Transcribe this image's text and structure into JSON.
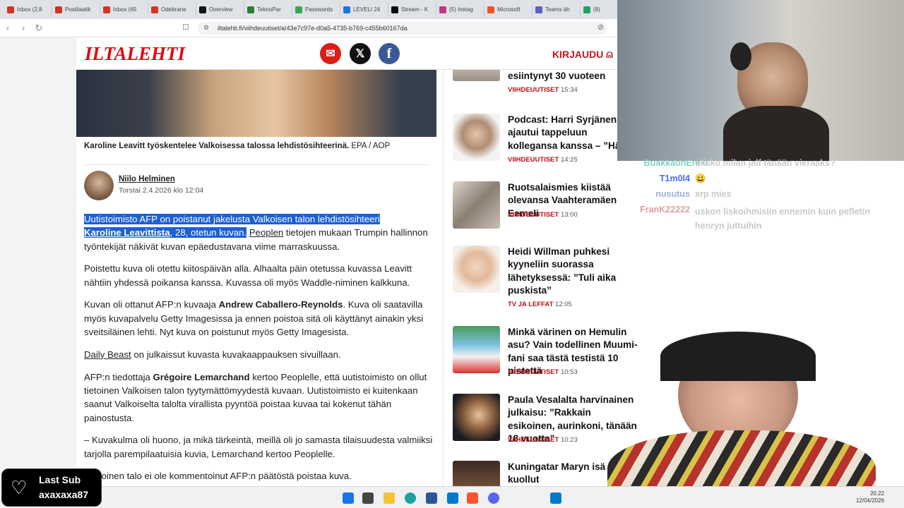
{
  "browser": {
    "tabs": [
      {
        "label": "Inbox (2,8",
        "color": "#d93025"
      },
      {
        "label": "Postilaatik",
        "color": "#d93025"
      },
      {
        "label": "Inbox (65",
        "color": "#d93025"
      },
      {
        "label": "Odebrane",
        "color": "#d93025"
      },
      {
        "label": "Overview",
        "color": "#111111"
      },
      {
        "label": "TeknoPar",
        "color": "#2e7d32"
      },
      {
        "label": "Passwords",
        "color": "#34a853"
      },
      {
        "label": "LEVELI 24",
        "color": "#1a73e8"
      },
      {
        "label": "Stream - K",
        "color": "#0a0a0a"
      },
      {
        "label": "(5) Instag",
        "color": "#c13584"
      },
      {
        "label": "Microsoft",
        "color": "#f25022"
      },
      {
        "label": "Teams äh",
        "color": "#5b5fc7"
      },
      {
        "label": "(8)",
        "color": "#1ea362"
      }
    ],
    "url": "iltalehti.fi/viihdeuutiset/a/43e7c97e-d0a5-4735-b769-c455b60167da"
  },
  "site": {
    "logo": "ILTALEHTI",
    "login": "KIRJAUDU",
    "colors": {
      "brand": "#e30613",
      "email": "#d91e18",
      "x": "#111111",
      "facebook": "#3b5998"
    }
  },
  "article": {
    "caption_bold": "Karoline Leavitt työskentelee Valkoisessa talossa lehdistösihteerinä.",
    "caption_source": " EPA / AOP",
    "author": "Niilo Helminen",
    "date": "Torstai 2.4.2026 klo 12:04",
    "p1_hl1": "Uutistoimisto AFP on poistanut jakelusta Valkoisen talon lehdistösihteeri",
    "p1_hl2_name": "Karoline Leavittista",
    "p1_hl2_rest": ", 28, otetun kuvan.",
    "p1_link": "Peoplen",
    "p1_rest": " tietojen mukaan Trumpin hallinnon työntekijät näkivät kuvan epäedustavana viime marraskuussa.",
    "p2": "Poistettu kuva oli otettu kiitospäivän alla. Alhaalta päin otetussa kuvassa Leavitt nähtiin yhdessä poikansa kanssa. Kuvassa oli myös Waddle-niminen kalkkuna.",
    "p3_a": "Kuvan oli ottanut AFP:n kuvaaja ",
    "p3_bold": "Andrew Caballero-Reynolds",
    "p3_b": ". Kuva oli saatavilla myös kuvapalvelu Getty Imagesissa ja ennen poistoa sitä oli käyttänyt ainakin yksi sveitsiläinen lehti. Nyt kuva on poistunut myös Getty Imagesista.",
    "p4_link": "Daily Beast",
    "p4_rest": " on julkaissut kuvasta kuvakaappauksen sivuillaan.",
    "p5_a": "AFP:n tiedottaja ",
    "p5_bold": "Grégoire Lemarchand",
    "p5_b": " kertoo Peoplelle, että uutistoimisto on ollut tietoinen Valkoisen talon tyytymättömyydestä kuvaan. Uutistoimisto ei kuitenkaan saanut Valkoiselta talolta virallista pyyntöä poistaa kuvaa tai kokenut tähän painostusta.",
    "p6": "– Kuvakulma oli huono, ja mikä tärkeintä, meillä oli jo samasta tilaisuudesta valmiiksi tarjolla parempilaatuisia kuvia, Lemarchand kertoo Peoplelle.",
    "p7": "Valkoinen talo ei ole kommentoinut AFP:n päätöstä poistaa kuva."
  },
  "sidebar_news": [
    {
      "title": "esiintynyt 30 vuoteen",
      "category": "VIIHDEUUTISET",
      "time": "15:34"
    },
    {
      "title": "Podcast: Harri Syrjänen ajautui tappeluun kollegansa kanssa – ”Hän oli niin raivon vallassa”",
      "category": "VIIHDEUUTISET",
      "time": "14:25"
    },
    {
      "title": "Ruotsalaismies kiistää olevansa Vaahteramäen Eemeli",
      "category": "VIIHDEUUTISET",
      "time": "13:00"
    },
    {
      "title": "Heidi Willman puhkesi kyyneliin suorassa lähetyksessä: ”Tuli aika puskista”",
      "category": "TV JA LEFFAT",
      "time": "12:05"
    },
    {
      "title": "Minkä värinen on Hemulin asu? Vain todellinen Muumi-fani saa tästä testistä 10 pistettä",
      "category": "VIIHDEUUTISET",
      "time": "10:53"
    },
    {
      "title": "Paula Vesalalta harvinainen julkaisu: ”Rakkain esikoinen, aurinkoni, tänään 18 vuotta”",
      "category": "VIIHDEUUTISET",
      "time": "10:23"
    },
    {
      "title": "Kuningatar Maryn isä on kuollut",
      "category": "",
      "time": ""
    }
  ],
  "chat": [
    {
      "user": "BuakkaonErkki",
      "msg": "olisko milan jalf tänään vieraaks?",
      "color": "#7fd1c0"
    },
    {
      "user": "T1m0l4",
      "msg": "😀",
      "color": "#4a6cf7"
    },
    {
      "user": "nusutus",
      "msg": "xrp mies",
      "color": "#9ab0d8"
    },
    {
      "user": "FranK22222",
      "msg": "uskon liskoihmisiin ennemin kuin pefletin henryn juttuihin",
      "color": "#e0a0a0"
    }
  ],
  "overlay": {
    "last_sub_label": "Last Sub",
    "last_sub_name": "axaxaxa87"
  },
  "taskbar": {
    "time": "20.22",
    "date": "12/04/2026"
  }
}
